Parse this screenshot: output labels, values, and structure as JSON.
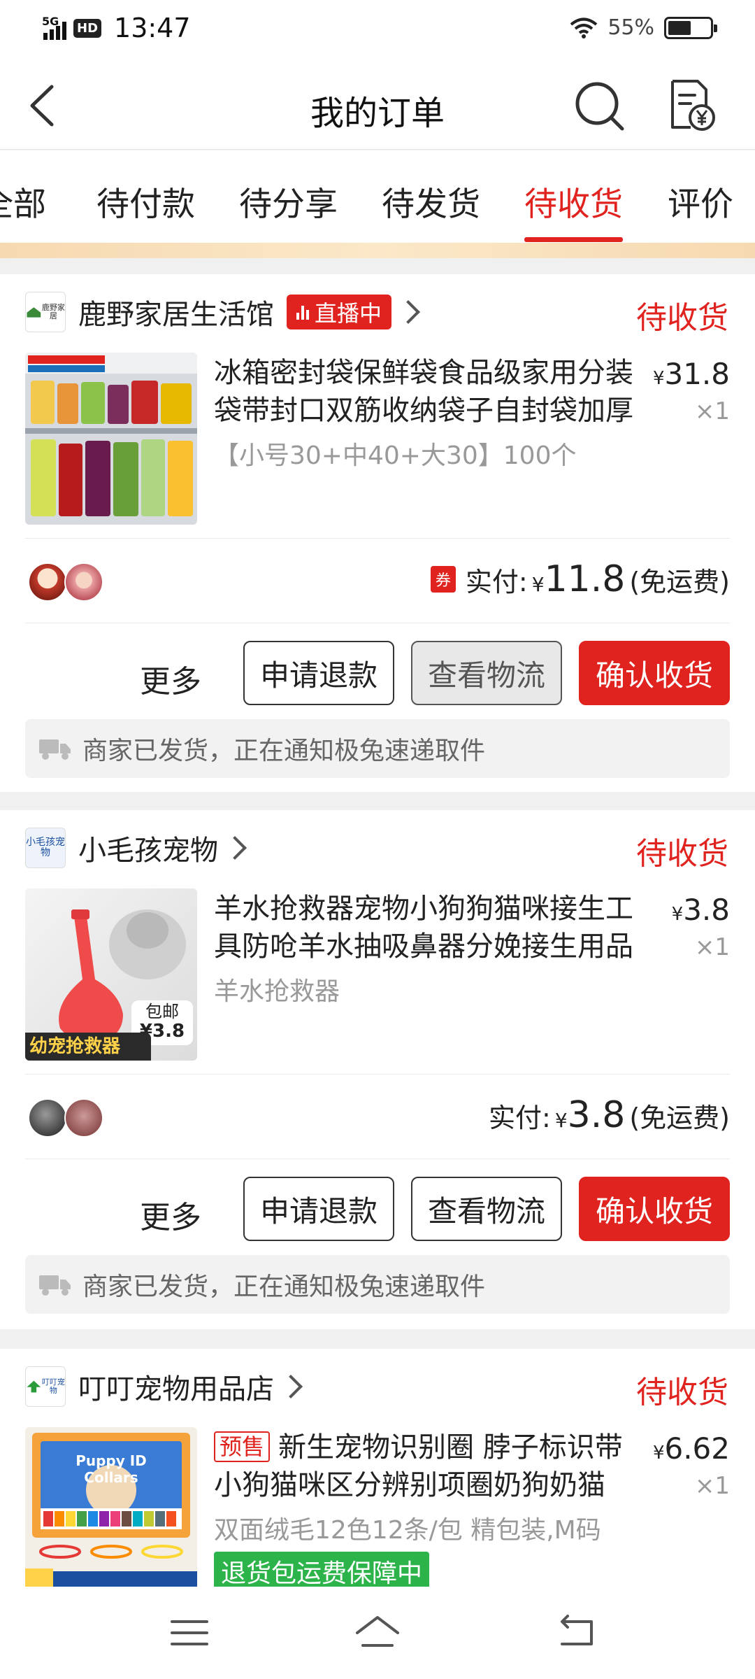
{
  "status_bar": {
    "network": "5G",
    "hd": "HD",
    "time": "13:47",
    "battery_percent": "55%",
    "battery_level": 0.55
  },
  "header": {
    "title": "我的订单",
    "back_icon": "chevron-left-icon",
    "search_icon": "search-icon",
    "receipt_icon": "receipt-yen-icon"
  },
  "tabs": [
    "全部",
    "待付款",
    "待分享",
    "待发货",
    "待收货",
    "评价"
  ],
  "active_tab": "待收货",
  "orders": [
    {
      "shop_name": "鹿野家居生活馆",
      "shop_logo_text": "鹿野家居",
      "live_tag": "直播中",
      "status": "待收货",
      "product_title": "冰箱密封袋保鲜袋食品级家用分装袋带封口双筋收纳袋子自封袋加厚",
      "sku": "【小号30+中40+大30】100个",
      "price_symbol": "¥",
      "price": "31.8",
      "qty": "×1",
      "coupon": "券",
      "paid_label": "实付:",
      "paid_symbol": "¥",
      "paid_amount": "11.8",
      "shipping": "(免运费)",
      "more": "更多",
      "btn_refund": "申请退款",
      "btn_logistics": "查看物流",
      "btn_confirm": "确认收货",
      "notice": "商家已发货，正在通知极兔速递取件"
    },
    {
      "shop_name": "小毛孩宠物",
      "shop_logo_text": "小毛孩宠物",
      "status": "待收货",
      "product_title": "羊水抢救器宠物小狗狗猫咪接生工具防呛羊水抽吸鼻器分娩接生用品",
      "sku": "羊水抢救器",
      "thumb_caption": "幼宠抢救器",
      "thumb_badge_top": "包邮",
      "thumb_badge_price": "¥3.8",
      "price_symbol": "¥",
      "price": "3.8",
      "qty": "×1",
      "paid_label": "实付:",
      "paid_symbol": "¥",
      "paid_amount": "3.8",
      "shipping": "(免运费)",
      "more": "更多",
      "btn_refund": "申请退款",
      "btn_logistics": "查看物流",
      "btn_confirm": "确认收货",
      "notice": "商家已发货，正在通知极兔速递取件"
    },
    {
      "shop_name": "叮叮宠物用品店",
      "shop_logo_text": "叮叮宠物",
      "status": "待收货",
      "presale": "预售",
      "product_title": "新生宠物识别圈 脖子标识带小狗猫咪区分辨别项圈奶狗奶猫",
      "sku": "双面绒毛12色12条/包 精包装,M码",
      "guarantee": "退货包运费保障中",
      "thumb_caption": "Puppy ID Collars",
      "price_symbol": "¥",
      "price": "6.62",
      "qty": "×1"
    }
  ],
  "bottom_nav": {
    "menu_icon": "menu-icon",
    "home_icon": "home-icon",
    "back_icon": "back-arrow-icon"
  },
  "colors": {
    "accent": "#e0231f",
    "green": "#2cb34a"
  }
}
